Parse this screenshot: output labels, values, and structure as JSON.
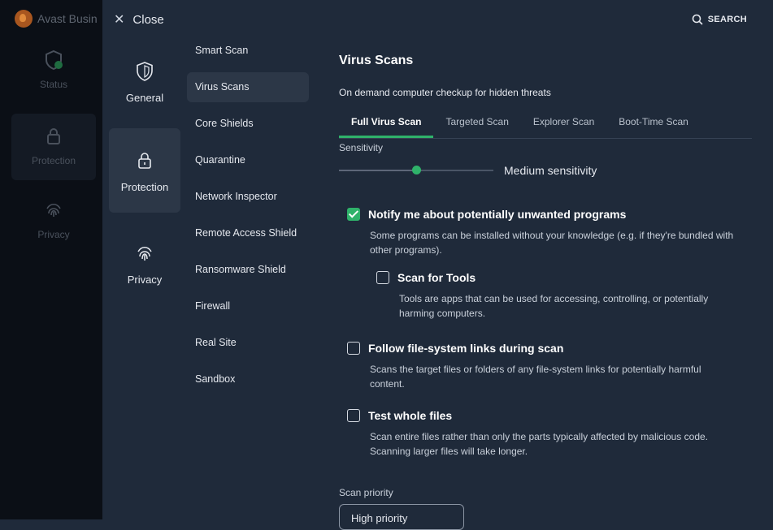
{
  "background_app": {
    "title": "Avast Busin",
    "nav": [
      {
        "label": "Status",
        "icon": "shield-check-icon"
      },
      {
        "label": "Protection",
        "icon": "lock-icon"
      },
      {
        "label": "Privacy",
        "icon": "fingerprint-icon"
      }
    ]
  },
  "header": {
    "close_label": "Close",
    "search_label": "SEARCH"
  },
  "categories": [
    {
      "label": "General",
      "icon": "shield-icon"
    },
    {
      "label": "Protection",
      "icon": "lock-icon"
    },
    {
      "label": "Privacy",
      "icon": "fingerprint-icon"
    }
  ],
  "subnav": [
    {
      "label": "Smart Scan"
    },
    {
      "label": "Virus Scans"
    },
    {
      "label": "Core Shields"
    },
    {
      "label": "Quarantine"
    },
    {
      "label": "Network Inspector"
    },
    {
      "label": "Remote Access Shield"
    },
    {
      "label": "Ransomware Shield"
    },
    {
      "label": "Firewall"
    },
    {
      "label": "Real Site"
    },
    {
      "label": "Sandbox"
    }
  ],
  "main": {
    "title": "Virus Scans",
    "description": "On demand computer checkup for hidden threats",
    "tabs": [
      {
        "label": "Full Virus Scan"
      },
      {
        "label": "Targeted Scan"
      },
      {
        "label": "Explorer Scan"
      },
      {
        "label": "Boot-Time Scan"
      }
    ],
    "sensitivity": {
      "label": "Sensitivity",
      "value": "Medium sensitivity",
      "level": 0.5
    },
    "options": [
      {
        "title": "Notify me about potentially unwanted programs",
        "desc": "Some programs can be installed without your knowledge (e.g. if they're bundled with other programs).",
        "checked": true
      },
      {
        "title": "Scan for Tools",
        "desc": "Tools are apps that can be used for accessing, controlling, or potentially harming computers.",
        "checked": false
      },
      {
        "title": "Follow file-system links during scan",
        "desc": "Scans the target files or folders of any file-system links for potentially harmful content.",
        "checked": false
      },
      {
        "title": "Test whole files",
        "desc": "Scan entire files rather than only the parts typically affected by malicious code. Scanning larger files will take longer.",
        "checked": false
      }
    ],
    "scan_priority": {
      "label": "Scan priority",
      "value": "High priority"
    }
  },
  "colors": {
    "accent": "#2fb26a",
    "panel_bg": "#1f2a3a",
    "selected_bg": "#2c3747",
    "back_app_bg": "#0b0f16"
  }
}
